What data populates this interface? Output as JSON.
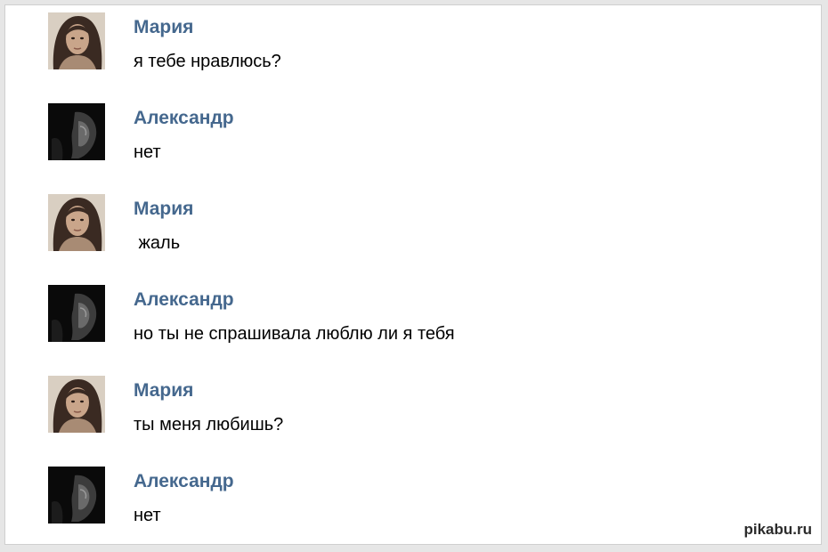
{
  "messages": [
    {
      "author": "Мария",
      "text": "я тебе нравлюсь?",
      "avatar": "maria-avatar"
    },
    {
      "author": "Александр",
      "text": "нет",
      "avatar": "alexander-avatar"
    },
    {
      "author": "Мария",
      "text": " жаль",
      "avatar": "maria-avatar"
    },
    {
      "author": "Александр",
      "text": "но ты не спрашивала люблю ли я тебя",
      "avatar": "alexander-avatar"
    },
    {
      "author": "Мария",
      "text": "ты меня любишь?",
      "avatar": "maria-avatar"
    },
    {
      "author": "Александр",
      "text": "нет",
      "avatar": "alexander-avatar"
    }
  ],
  "watermark": "pikabu.ru",
  "colors": {
    "author_name": "#45688e",
    "background": "#ffffff"
  }
}
